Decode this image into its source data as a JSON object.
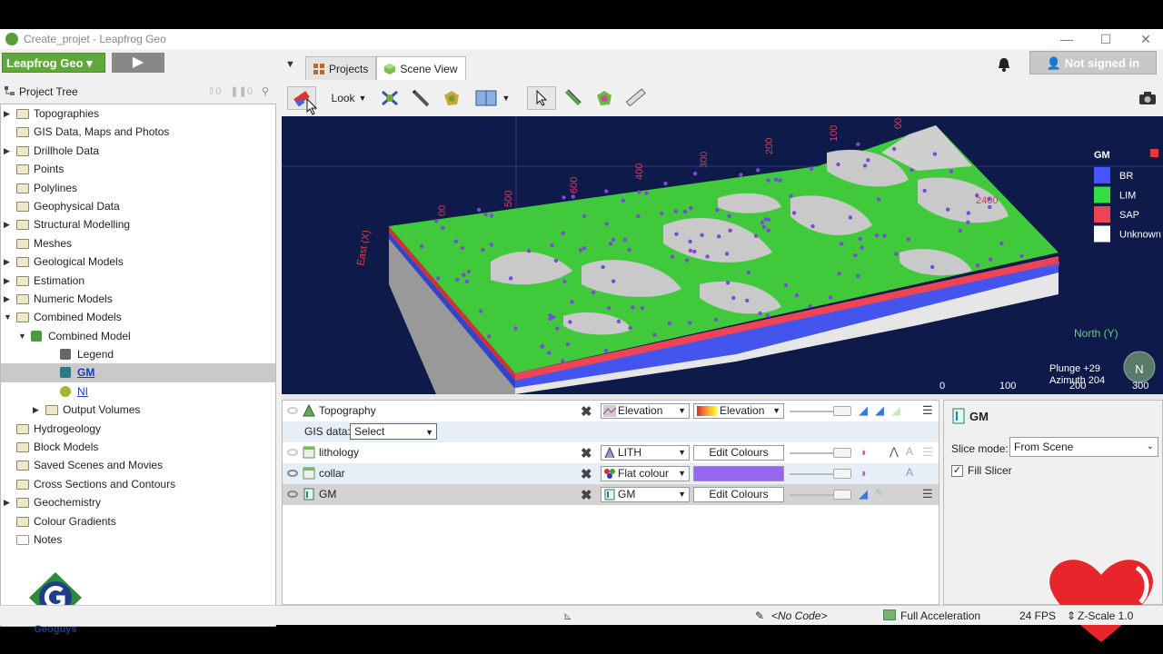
{
  "window": {
    "title": "Create_projet - Leapfrog Geo",
    "minimize": "—",
    "maximize": "☐",
    "close": "✕"
  },
  "app_bar": {
    "brand": "Leapfrog Geo ▾",
    "play": "▶",
    "signin": "Not signed in"
  },
  "tabs": [
    {
      "label": "Projects"
    },
    {
      "label": "Scene View"
    }
  ],
  "project_tree": {
    "header": "Project Tree",
    "counts": {
      "up": "0",
      "pause": "0"
    },
    "items": [
      {
        "label": "Topographies",
        "level": 0,
        "expand": "closed",
        "kind": "folder"
      },
      {
        "label": "GIS Data, Maps and Photos",
        "level": 0,
        "expand": "none",
        "kind": "folder"
      },
      {
        "label": "Drillhole Data",
        "level": 0,
        "expand": "closed",
        "kind": "folder"
      },
      {
        "label": "Points",
        "level": 0,
        "expand": "none",
        "kind": "folder"
      },
      {
        "label": "Polylines",
        "level": 0,
        "expand": "none",
        "kind": "folder"
      },
      {
        "label": "Geophysical Data",
        "level": 0,
        "expand": "none",
        "kind": "folder"
      },
      {
        "label": "Structural Modelling",
        "level": 0,
        "expand": "closed",
        "kind": "folder"
      },
      {
        "label": "Meshes",
        "level": 0,
        "expand": "none",
        "kind": "folder"
      },
      {
        "label": "Geological Models",
        "level": 0,
        "expand": "closed",
        "kind": "folder"
      },
      {
        "label": "Estimation",
        "level": 0,
        "expand": "closed",
        "kind": "folder"
      },
      {
        "label": "Numeric Models",
        "level": 0,
        "expand": "closed",
        "kind": "folder"
      },
      {
        "label": "Combined Models",
        "level": 0,
        "expand": "open",
        "kind": "folder"
      },
      {
        "label": "Combined Model",
        "level": 1,
        "expand": "open",
        "kind": "model"
      },
      {
        "label": "Legend",
        "level": 2,
        "expand": "none",
        "kind": "legend"
      },
      {
        "label": "GM",
        "level": 2,
        "expand": "none",
        "kind": "gm",
        "selected": true
      },
      {
        "label": "NI",
        "level": 2,
        "expand": "none",
        "kind": "ni"
      },
      {
        "label": "Output Volumes",
        "level": 2,
        "expand": "closed",
        "kind": "folder"
      },
      {
        "label": "Hydrogeology",
        "level": 0,
        "expand": "none",
        "kind": "folder"
      },
      {
        "label": "Block Models",
        "level": 0,
        "expand": "none",
        "kind": "folder"
      },
      {
        "label": "Saved Scenes and Movies",
        "level": 0,
        "expand": "none",
        "kind": "folder"
      },
      {
        "label": "Cross Sections and Contours",
        "level": 0,
        "expand": "none",
        "kind": "folder"
      },
      {
        "label": "Geochemistry",
        "level": 0,
        "expand": "closed",
        "kind": "folder"
      },
      {
        "label": "Colour Gradients",
        "level": 0,
        "expand": "none",
        "kind": "folder"
      },
      {
        "label": "Notes",
        "level": 0,
        "expand": "none",
        "kind": "note"
      }
    ]
  },
  "watermark": {
    "text": "Geoguys"
  },
  "toolbar": {
    "look": "Look"
  },
  "scene": {
    "legend_title": "GM",
    "legend": [
      {
        "label": "BR",
        "color": "#4455ff"
      },
      {
        "label": "LIM",
        "color": "#33dd44"
      },
      {
        "label": "SAP",
        "color": "#ee4455"
      },
      {
        "label": "Unknown",
        "color": "#ffffff"
      }
    ],
    "plunge": "Plunge +29",
    "azimuth": "Azimuth 204",
    "scale_ticks": [
      "0",
      "100",
      "200",
      "300"
    ],
    "axis_x": "East (X)",
    "axis_y": "North (Y)",
    "tick_labels": [
      "00",
      "500",
      "600",
      "400",
      "300",
      "200",
      "100",
      "00",
      "2400",
      "600"
    ]
  },
  "layers": {
    "topography": {
      "name": "Topography",
      "sel1": "Elevation",
      "sel2": "Elevation"
    },
    "gis": {
      "label": "GIS data:",
      "value": "Select"
    },
    "lithology": {
      "name": "lithology",
      "sel1": "LITH",
      "sel2": "Edit Colours"
    },
    "collar": {
      "name": "collar",
      "sel1": "Flat colour",
      "color": "#9966ee"
    },
    "gm": {
      "name": "GM",
      "sel1": "GM",
      "sel2": "Edit Colours"
    }
  },
  "props": {
    "title": "GM",
    "slice_label": "Slice mode:",
    "slice_value": "From Scene",
    "fill_label": "Fill Slicer",
    "fill_checked": "✓"
  },
  "status": {
    "code": "<No Code>",
    "accel": "Full Acceleration",
    "fps": "24 FPS",
    "zscale": "Z-Scale 1.0"
  }
}
